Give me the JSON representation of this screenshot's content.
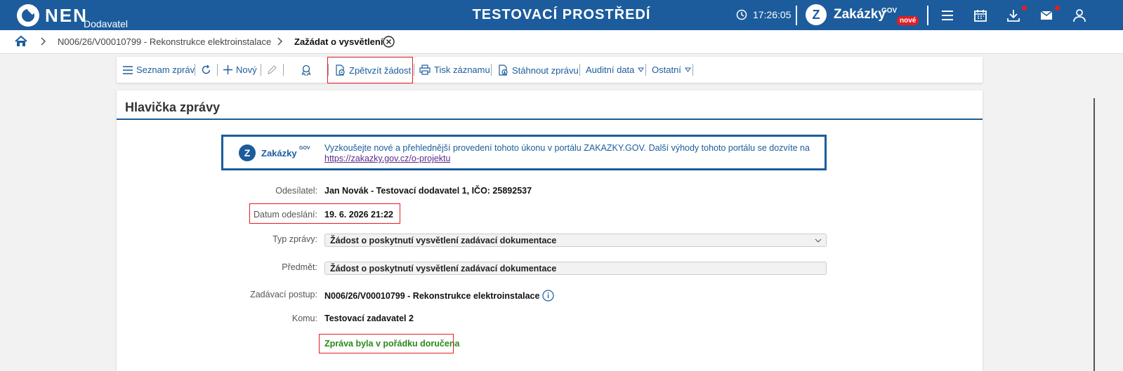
{
  "header": {
    "brand": "NEN",
    "brand_sub": "Dodavatel",
    "env_title": "TESTOVACÍ PROSTŘEDÍ",
    "time": "17:26:05",
    "zakazky_label": "Zakázky",
    "zakazky_gov": "GOV",
    "zakazky_badge": "nové",
    "accent_color": "#1c5c9c",
    "badge_color": "#e31e24"
  },
  "breadcrumb": {
    "item1": "N006/26/V00010799 - Rekonstrukce elektroinstalace",
    "item2": "Zažádat o vysvětlení"
  },
  "toolbar": {
    "seznam": "Seznam zpráv",
    "novy": "Nový",
    "zpetvzit": "Zpětvzít žádost",
    "tisk": "Tisk záznamu",
    "stahnout": "Stáhnout zprávu",
    "auditni": "Auditní data",
    "ostatni": "Ostatní"
  },
  "card": {
    "title": "Hlavička zprávy",
    "banner": {
      "name": "Zakázky",
      "gov": "GOV",
      "text": "Vyzkoušejte nové a přehlednější provedení tohoto úkonu v portálu ZAKAZKY.GOV. Další výhody tohoto portálu se dozvíte na",
      "link": "https://zakazky.gov.cz/o-projektu"
    },
    "fields": {
      "odesilatel_label": "Odesílatel:",
      "odesilatel_value": "Jan Novák - Testovací dodavatel 1, IČO: 25892537",
      "datum_label": "Datum odeslání:",
      "datum_value": "19. 6. 2026 21:22",
      "typ_label": "Typ zprávy:",
      "typ_value": "Žádost o poskytnutí vysvětlení zadávací dokumentace",
      "predmet_label": "Předmět:",
      "predmet_value": "Žádost o poskytnutí vysvětlení zadávací dokumentace",
      "postup_label": "Zadávací postup:",
      "postup_value": "N006/26/V00010799 - Rekonstrukce elektroinstalace",
      "komu_label": "Komu:",
      "komu_value": "Testovací zadavatel 2",
      "status": "Zpráva byla v pořádku doručena"
    }
  }
}
